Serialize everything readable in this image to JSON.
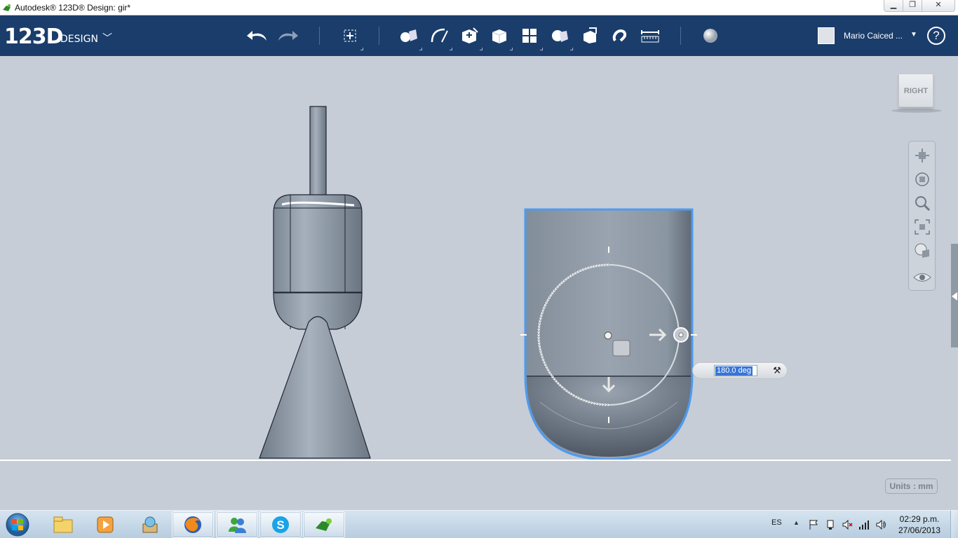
{
  "window": {
    "title": "Autodesk® 123D® Design: gir*",
    "controls": {
      "minimize": "▁",
      "maximize": "❐",
      "close": "✕"
    }
  },
  "toolbar": {
    "logo_main": "123D",
    "logo_sub": "DESIGN",
    "icons": [
      "undo-icon",
      "redo-icon",
      "transform-icon",
      "primitives-icon",
      "sketch-icon",
      "construct-icon",
      "modify-icon",
      "pattern-icon",
      "group-icon",
      "combine-icon",
      "snap-icon",
      "measure-icon",
      "material-icon"
    ],
    "user_name": "Mario Caiced ...",
    "help_label": "?"
  },
  "viewport": {
    "viewcube_label": "RIGHT",
    "units_label": "Units : mm",
    "angle_value": "180.0 deg",
    "nav_tools": [
      "pan-icon",
      "orbit-icon",
      "zoom-icon",
      "fit-icon",
      "view-style-icon",
      "visibility-icon"
    ]
  },
  "taskbar": {
    "apps": [
      "windows-explorer",
      "media-player",
      "app-installer",
      "firefox",
      "messenger",
      "skype",
      "123d-design"
    ],
    "language": "ES",
    "time": "02:29 p.m.",
    "date": "27/06/2013"
  },
  "colors": {
    "toolbar_bg": "#1a3d6b",
    "viewport_bg": "#c6cdd6",
    "selection_outline": "#4d9bf0"
  }
}
